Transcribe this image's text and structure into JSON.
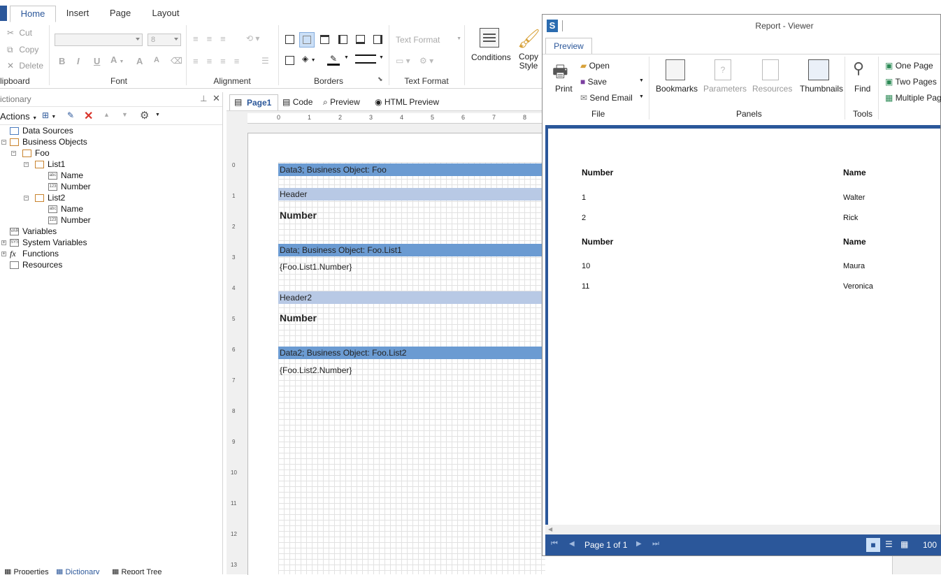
{
  "ribbon": {
    "tabs": [
      "Home",
      "Insert",
      "Page",
      "Layout"
    ],
    "clipboard": {
      "cut": "Cut",
      "copy": "Copy",
      "delete": "Delete",
      "label": "lipboard"
    },
    "font": {
      "name_value": "",
      "size_value": "8",
      "bold": "B",
      "italic": "I",
      "underline": "U",
      "grow": "A",
      "shrink": "A",
      "label": "Font"
    },
    "alignment_label": "Alignment",
    "borders_label": "Borders",
    "text_format": {
      "value": "Text Format",
      "label": "Text Format"
    },
    "conditions": "Conditions",
    "copy_style_line1": "Copy",
    "copy_style_line2": "Style"
  },
  "dictionary": {
    "title": "ictionary",
    "actions": "Actions",
    "tree": {
      "data_sources": "Data Sources",
      "business_objects": "Business Objects",
      "foo": "Foo",
      "list1": "List1",
      "list1_name": "Name",
      "list1_number": "Number",
      "list2": "List2",
      "list2_name": "Name",
      "list2_number": "Number",
      "variables": "Variables",
      "system_variables": "System Variables",
      "functions": "Functions",
      "resources": "Resources"
    },
    "bottom_tabs": [
      "Properties",
      "Dictionary",
      "Report Tree"
    ]
  },
  "designer": {
    "tabs": [
      "Page1",
      "Code",
      "Preview",
      "HTML Preview"
    ],
    "ruler_h": [
      "0",
      "1",
      "2",
      "3",
      "4",
      "5",
      "6",
      "7",
      "8"
    ],
    "ruler_v": [
      "0",
      "1",
      "2",
      "3",
      "4",
      "5",
      "6",
      "7",
      "8",
      "9",
      "10",
      "11",
      "12",
      "13"
    ],
    "bands": {
      "data3": "Data3; Business Object: Foo",
      "header": "Header",
      "header_text": "Number",
      "data": "Data; Business Object: Foo.List1",
      "data_field": "{Foo.List1.Number}",
      "header2": "Header2",
      "header2_text": "Number",
      "data2": "Data2; Business Object: Foo.List2",
      "data2_field": "{Foo.List2.Number}"
    }
  },
  "viewer": {
    "title": "Report - Viewer",
    "tab": "Preview",
    "print": "Print",
    "open": "Open",
    "save": "Save",
    "send_email": "Send Email",
    "file_label": "File",
    "bookmarks": "Bookmarks",
    "parameters": "Parameters",
    "resources": "Resources",
    "thumbnails": "Thumbnails",
    "panels_label": "Panels",
    "find": "Find",
    "tools_label": "Tools",
    "one_page": "One Page",
    "two_pages": "Two Pages",
    "multiple_pages": "Multiple Pag",
    "report": {
      "group1": {
        "col1": "Number",
        "col2": "Name",
        "rows": [
          {
            "number": "1",
            "name": "Walter"
          },
          {
            "number": "2",
            "name": "Rick"
          }
        ]
      },
      "group2": {
        "col1": "Number",
        "col2": "Name",
        "rows": [
          {
            "number": "10",
            "name": "Maura"
          },
          {
            "number": "11",
            "name": "Veronica"
          }
        ]
      }
    },
    "page_info": "Page 1 of 1",
    "zoom": "100"
  },
  "colors": {
    "accent": "#2b579a",
    "band_dark": "#6b9bd2",
    "band_light": "#b8c9e5"
  }
}
